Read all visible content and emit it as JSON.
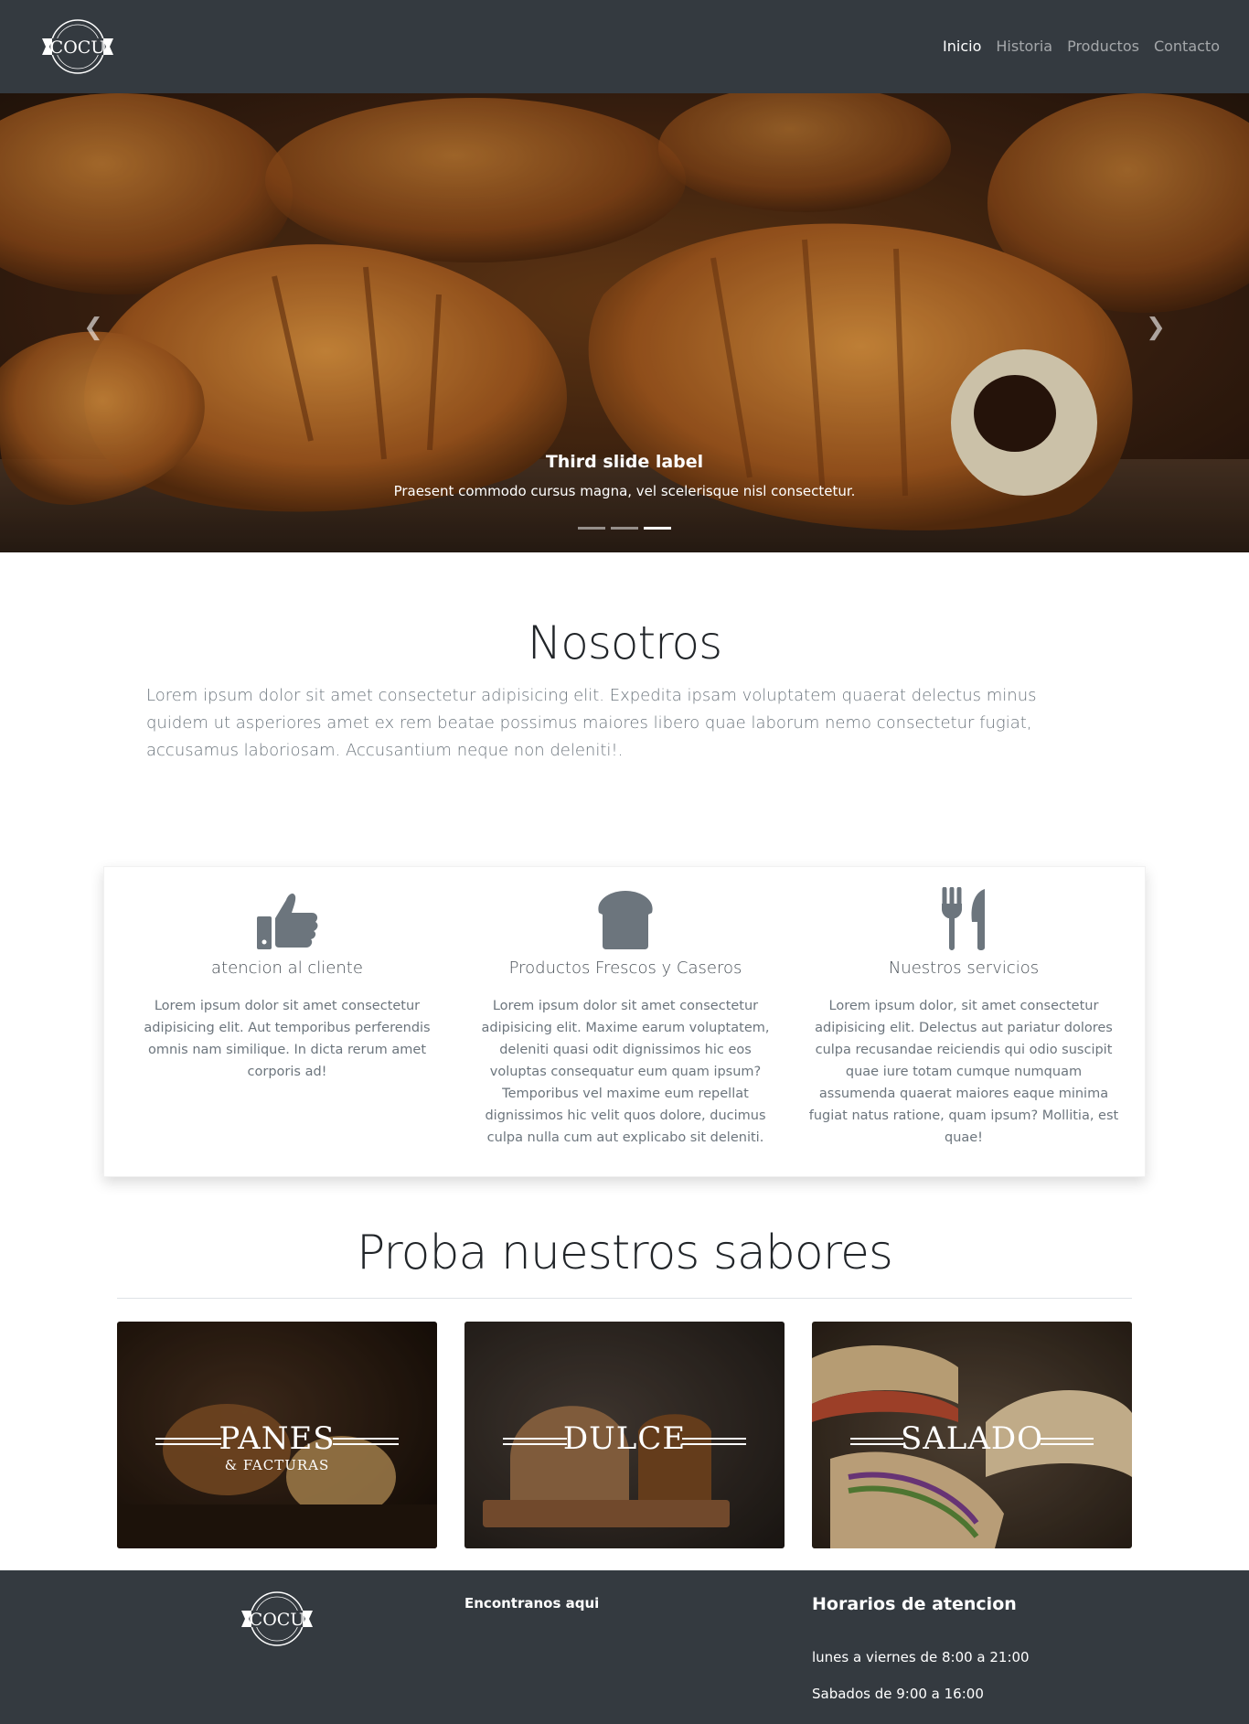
{
  "brand": {
    "logo_text": "COCU",
    "logo_ring_text": "PANADERÍA"
  },
  "nav": {
    "items": [
      {
        "label": "Inicio",
        "active": true
      },
      {
        "label": "Historia",
        "active": false
      },
      {
        "label": "Productos",
        "active": false
      },
      {
        "label": "Contacto",
        "active": false
      }
    ]
  },
  "carousel": {
    "caption_title": "Third slide label",
    "caption_text": "Praesent commodo cursus magna, vel scelerisque nisl consectetur.",
    "prev_icon": "chevron-left-icon",
    "next_icon": "chevron-right-icon",
    "slides_count": 3,
    "active_slide": 3
  },
  "nosotros": {
    "title": "Nosotros",
    "text": "Lorem ipsum dolor sit amet consectetur adipisicing elit. Expedita ipsam voluptatem quaerat delectus minus quidem ut asperiores amet ex rem beatae possimus maiores libero quae laborum nemo consectetur fugiat, accusamus laboriosam. Accusantium neque non deleniti!."
  },
  "features": [
    {
      "icon": "thumbs-up-icon",
      "title": "atencion al cliente",
      "text": "Lorem ipsum dolor sit amet consectetur adipisicing elit. Aut temporibus perferendis omnis nam similique. In dicta rerum amet corporis ad!"
    },
    {
      "icon": "bread-icon",
      "title": "Productos Frescos y Caseros",
      "text": "Lorem ipsum dolor sit amet consectetur adipisicing elit. Maxime earum voluptatem, deleniti quasi odit dignissimos hic eos voluptas consequatur eum quam ipsum? Temporibus vel maxime eum repellat dignissimos hic velit quos dolore, ducimus culpa nulla cum aut explicabo sit deleniti."
    },
    {
      "icon": "utensils-icon",
      "title": "Nuestros servicios",
      "text": "Lorem ipsum dolor, sit amet consectetur adipisicing elit. Delectus aut pariatur dolores culpa recusandae reiciendis qui odio suscipit quae iure totam cumque numquam assumenda quaerat maiores eaque minima fugiat natus ratione, quam ipsum? Mollitia, est quae!"
    }
  ],
  "proba": {
    "title": "Proba nuestros sabores",
    "tiles": [
      {
        "label": "PANES",
        "sub": "& FACTURAS"
      },
      {
        "label": "DULCE",
        "sub": ""
      },
      {
        "label": "SALADO",
        "sub": ""
      }
    ]
  },
  "footer": {
    "find_us": "Encontranos aqui",
    "hours_title": "Horarios de atencion",
    "hours_weekdays": "lunes a viernes de 8:00 a 21:00",
    "hours_saturday": "Sabados de 9:00 a 16:00"
  },
  "colors": {
    "nav_bg": "#343a40",
    "icon_gray": "#6c757d",
    "muted_text": "#6c757d"
  }
}
